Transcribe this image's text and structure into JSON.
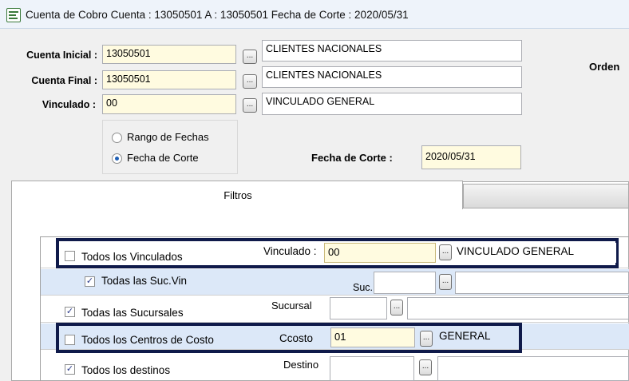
{
  "window": {
    "title": "Cuenta de Cobro    Cuenta : 13050501 A : 13050501   Fecha de Corte : 2020/05/31"
  },
  "header": {
    "cuenta_inicial": {
      "label": "Cuenta Inicial :",
      "value": "13050501",
      "desc": "CLIENTES NACIONALES"
    },
    "cuenta_final": {
      "label": "Cuenta Final :",
      "value": "13050501",
      "desc": "CLIENTES NACIONALES"
    },
    "vinculado": {
      "label": "Vinculado :",
      "value": "00",
      "desc": "VINCULADO GENERAL"
    },
    "orden_label": "Orden",
    "dots": "...",
    "radio_rango": "Rango de Fechas",
    "radio_corte": "Fecha de Corte",
    "fecha_corte_label": "Fecha de Corte :",
    "fecha_corte_value": "2020/05/31"
  },
  "tabs": {
    "filtros": "Filtros"
  },
  "filters": {
    "todos_vinculados": "Todos los Vinculados",
    "vinculado_label": "Vinculado :",
    "vinculado_value": "00",
    "vinculado_desc": "VINCULADO GENERAL",
    "todas_suc_vin": "Todas las Suc.Vin",
    "suc_label": "Suc.",
    "todas_sucursales": "Todas las Sucursales",
    "sucursal_label": "Sucursal",
    "todos_centros": "Todos los Centros de Costo",
    "ccosto_label": "Ccosto",
    "ccosto_value": "01",
    "ccosto_desc": "GENERAL",
    "todos_destinos": "Todos los destinos",
    "destino_label": "Destino",
    "check_mark": "✓"
  },
  "colors": {
    "highlight": "#0f1a4a",
    "input_yellow": "#fffbe0",
    "row_alt": "#dce8f8"
  }
}
